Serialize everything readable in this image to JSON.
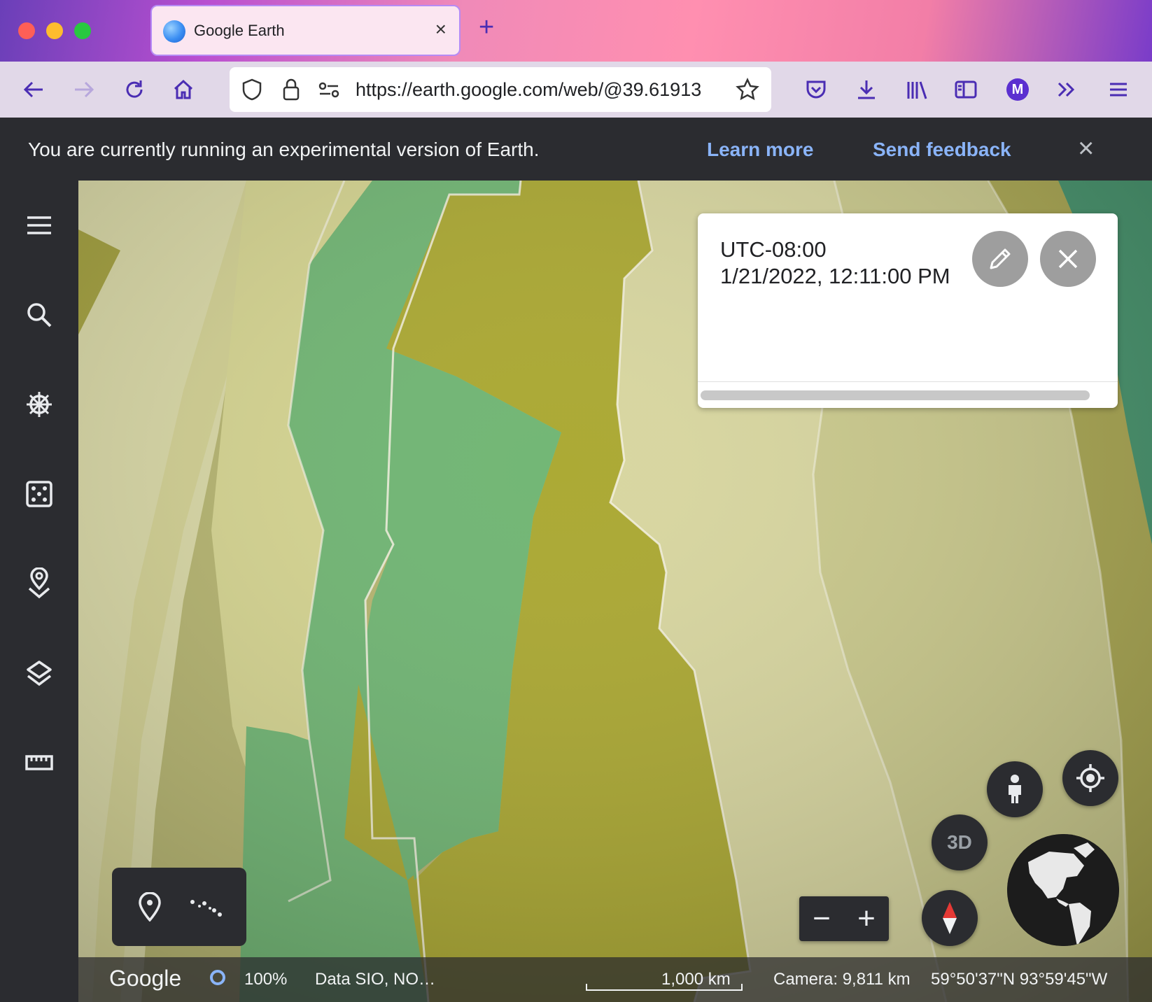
{
  "browser": {
    "tab_title": "Google Earth",
    "tab_close": "×",
    "new_tab": "+",
    "url": "https://earth.google.com/web/@39.61913",
    "profile_initial": "M"
  },
  "banner": {
    "message": "You are currently running an experimental version of Earth.",
    "learn_more": "Learn more",
    "send_feedback": "Send feedback",
    "close": "×"
  },
  "info_card": {
    "timezone": "UTC-08:00",
    "datetime": "1/21/2022, 12:11:00 PM"
  },
  "controls": {
    "mode_3d": "3D",
    "zoom_out": "−",
    "zoom_in": "+"
  },
  "status": {
    "logo": "Google",
    "load_percent": "100%",
    "data_attribution": "Data SIO, NO…",
    "scale": "1,000 km",
    "camera": "Camera: 9,811 km",
    "coordinates": "59°50'37\"N 93°59'45\"W"
  },
  "colors": {
    "banner_link": "#8ab4f8",
    "zone_olive": "#a8a52a",
    "zone_green": "#6bb36e",
    "zone_pale": "#d9d69a"
  },
  "icons": {
    "sidebar": [
      "menu-icon",
      "search-icon",
      "voyager-icon",
      "feeling-lucky-icon",
      "projects-icon",
      "map-style-icon",
      "measure-icon"
    ]
  }
}
